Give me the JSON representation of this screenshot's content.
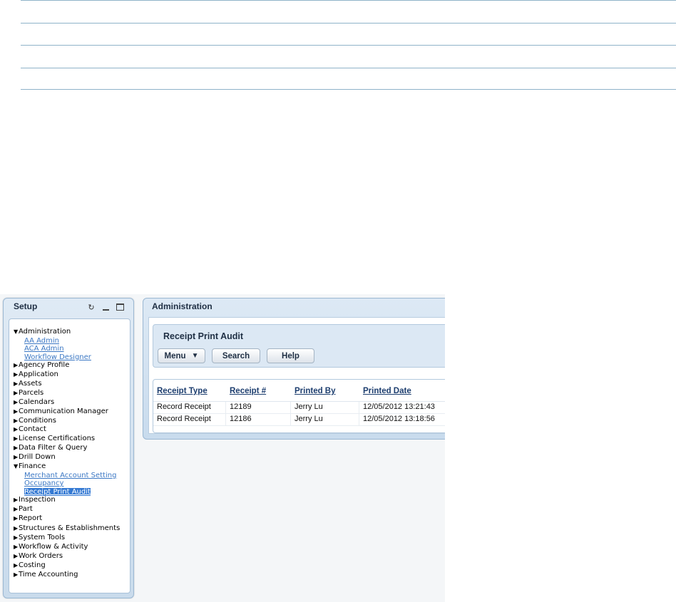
{
  "setup_panel": {
    "title": "Setup",
    "tree": {
      "administration": {
        "label": "Administration",
        "children": [
          "AA Admin",
          "ACA Admin",
          "Workflow Designer"
        ]
      },
      "collapsed_a": [
        "Agency Profile",
        "Application",
        "Assets",
        "Parcels",
        "Calendars",
        "Communication Manager",
        "Conditions",
        "Contact",
        "License Certifications",
        "Data Filter & Query",
        "Drill Down"
      ],
      "finance": {
        "label": "Finance",
        "children": [
          "Merchant Account Setting",
          "Occupancy",
          "Receipt Print Audit"
        ]
      },
      "collapsed_b": [
        "Inspection",
        "Part",
        "Report",
        "Structures & Establishments",
        "System Tools",
        "Workflow & Activity",
        "Work Orders",
        "Costing",
        "Time Accounting"
      ]
    },
    "icons": {
      "expanded": "triangle-down-icon",
      "collapsed": "triangle-right-icon"
    }
  },
  "admin_panel": {
    "title": "Administration",
    "section_title": "Receipt Print Audit",
    "buttons": {
      "menu": "Menu",
      "search": "Search",
      "help": "Help"
    },
    "table": {
      "columns": [
        "Receipt Type",
        "Receipt #",
        "Printed By",
        "Printed Date"
      ],
      "rows": [
        [
          "Record Receipt",
          "12189",
          "Jerry Lu",
          "12/05/2012 13:21:43"
        ],
        [
          "Record Receipt",
          "12186",
          "Jerry Lu",
          "12/05/2012 13:18:56"
        ]
      ]
    }
  },
  "colors": {
    "link": "#3c78c4",
    "selected_bg": "#3479d3",
    "header_text": "#1c3d6e",
    "panel_border": "#9ab7d2"
  }
}
